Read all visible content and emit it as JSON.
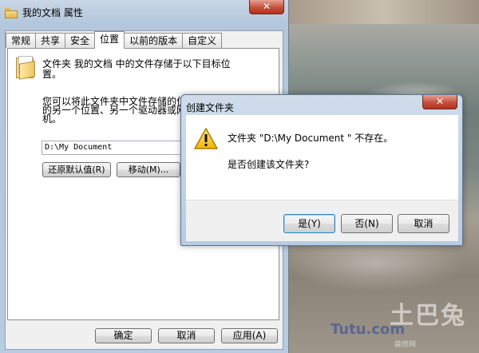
{
  "properties_window": {
    "title": "我的文档 属性",
    "close_glyph": "✕",
    "tabs": [
      {
        "label": "常规"
      },
      {
        "label": "共享"
      },
      {
        "label": "安全"
      },
      {
        "label": "位置",
        "active": true
      },
      {
        "label": "以前的版本"
      },
      {
        "label": "自定义"
      }
    ],
    "location": {
      "description_line1": "文件夹 我的文档 中的文件存储于以下目标位",
      "description_line2": "置。",
      "info_line1": "您可以将此文件夹中文件存储的位",
      "info_line2": "的另一个位置、另一个驱动器或网",
      "info_line3": "机。",
      "path_value": "D:\\My Document",
      "restore_default_label": "还原默认值(R)",
      "move_label": "移动(M)..."
    },
    "footer": {
      "ok_label": "确定",
      "cancel_label": "取消",
      "apply_label": "应用(A)"
    }
  },
  "create_folder_dialog": {
    "title": "创建文件夹",
    "close_glyph": "✕",
    "message_line1": "文件夹 \"D:\\My Document \" 不存在。",
    "message_line2": "是否创建该文件夹?",
    "icon": "warning-icon",
    "yes_label": "是(Y)",
    "no_label": "否(N)",
    "cancel_label": "取消"
  },
  "watermark": {
    "text_cn": "土巴兔",
    "text_url": "Tutu.com",
    "text_sub": "装修网"
  }
}
